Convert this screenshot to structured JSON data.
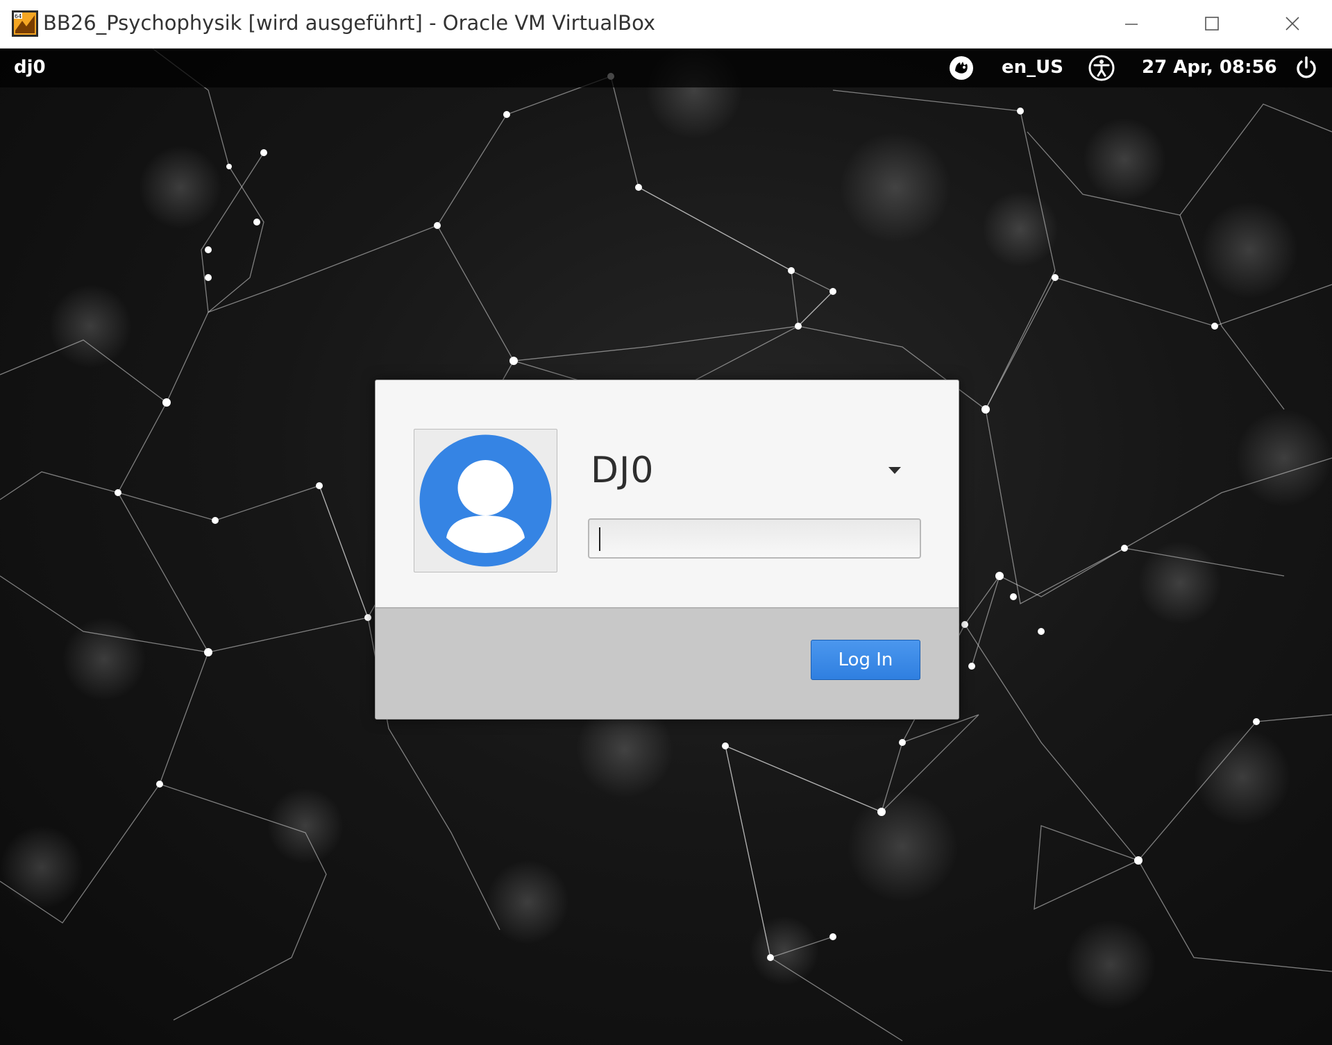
{
  "window": {
    "title": "BB26_Psychophysik [wird ausgeführt] - Oracle VM VirtualBox",
    "app_icon": "virtualbox-icon",
    "controls": {
      "minimize": "minimize-icon",
      "maximize": "maximize-icon",
      "close": "close-icon"
    }
  },
  "top_panel": {
    "hostname": "dj0",
    "locale": "en_US",
    "datetime": "27 Apr, 08:56",
    "icons": [
      "session-icon",
      "accessibility-icon",
      "power-icon"
    ]
  },
  "login": {
    "username": "DJ0",
    "avatar": "user-avatar-icon",
    "password_value": "",
    "login_label": "Log In",
    "accent_color": "#3584e4"
  }
}
